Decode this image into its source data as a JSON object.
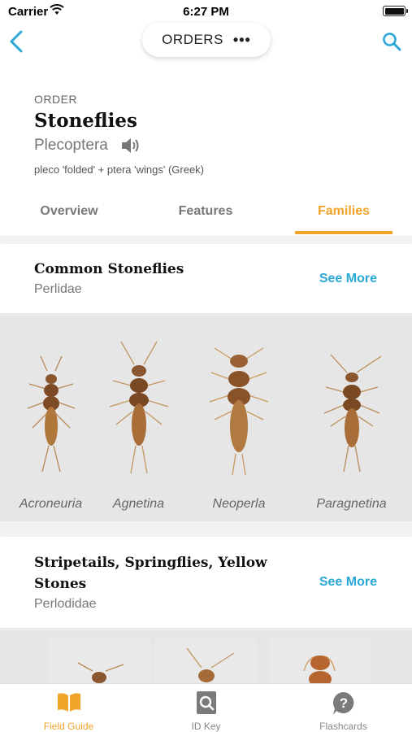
{
  "status_bar": {
    "carrier": "Carrier",
    "time": "6:27 PM"
  },
  "nav": {
    "title": "ORDERS",
    "more": "•••"
  },
  "order": {
    "label": "ORDER",
    "name": "Stoneflies",
    "scientific": "Plecoptera",
    "etymology": "pleco 'folded' + ptera 'wings' (Greek)"
  },
  "tabs": [
    {
      "label": "Overview"
    },
    {
      "label": "Features"
    },
    {
      "label": "Families"
    }
  ],
  "families": [
    {
      "title": "Common Stoneflies",
      "latin": "Perlidae",
      "see_more": "See More",
      "genera": [
        "Acroneuria",
        "Agnetina",
        "Neoperla",
        "Paragnetina"
      ]
    },
    {
      "title": "Stripetails, Springflies, Yellow Stones",
      "latin": "Perlodidae",
      "see_more": "See More"
    }
  ],
  "tabbar": [
    {
      "label": "Field Guide",
      "icon": "book-icon"
    },
    {
      "label": "ID Key",
      "icon": "id-key-icon"
    },
    {
      "label": "Flashcards",
      "icon": "question-icon"
    }
  ],
  "colors": {
    "accent": "#f0a52a",
    "link": "#2aa8d8",
    "nav_icon": "#2aa8d8"
  }
}
